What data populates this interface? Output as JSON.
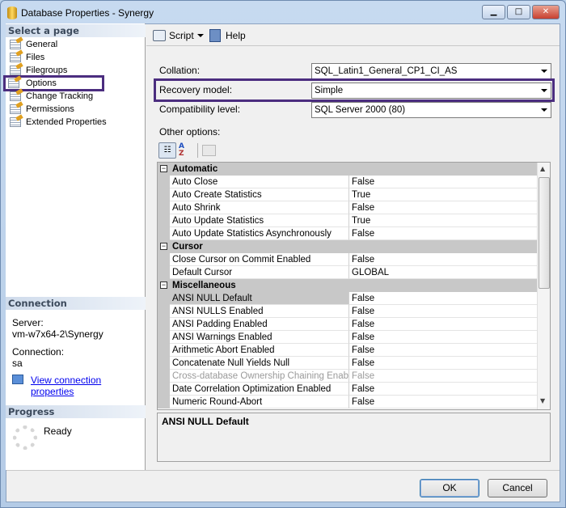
{
  "window": {
    "title": "Database Properties - Synergy"
  },
  "sidebar": {
    "header": "Select a page",
    "items": [
      {
        "label": "General"
      },
      {
        "label": "Files"
      },
      {
        "label": "Filegroups"
      },
      {
        "label": "Options",
        "selected": true
      },
      {
        "label": "Change Tracking"
      },
      {
        "label": "Permissions"
      },
      {
        "label": "Extended Properties"
      }
    ]
  },
  "connection": {
    "header": "Connection",
    "server_label": "Server:",
    "server": "vm-w7x64-2\\Synergy",
    "connection_label": "Connection:",
    "connection": "sa",
    "link": "View connection properties"
  },
  "progress": {
    "header": "Progress",
    "status": "Ready"
  },
  "toolbar": {
    "script": "Script",
    "help": "Help"
  },
  "form": {
    "collation_label": "Collation:",
    "collation": "SQL_Latin1_General_CP1_CI_AS",
    "recovery_label": "Recovery model:",
    "recovery": "Simple",
    "compat_label": "Compatibility level:",
    "compat": "SQL Server 2000 (80)",
    "other_label": "Other options:"
  },
  "grid": {
    "categories": [
      {
        "name": "Automatic",
        "rows": [
          [
            "Auto Close",
            "False"
          ],
          [
            "Auto Create Statistics",
            "True"
          ],
          [
            "Auto Shrink",
            "False"
          ],
          [
            "Auto Update Statistics",
            "True"
          ],
          [
            "Auto Update Statistics Asynchronously",
            "False"
          ]
        ]
      },
      {
        "name": "Cursor",
        "rows": [
          [
            "Close Cursor on Commit Enabled",
            "False"
          ],
          [
            "Default Cursor",
            "GLOBAL"
          ]
        ]
      },
      {
        "name": "Miscellaneous",
        "rows": [
          [
            "ANSI NULL Default",
            "False"
          ],
          [
            "ANSI NULLS Enabled",
            "False"
          ],
          [
            "ANSI Padding Enabled",
            "False"
          ],
          [
            "ANSI Warnings Enabled",
            "False"
          ],
          [
            "Arithmetic Abort Enabled",
            "False"
          ],
          [
            "Concatenate Null Yields Null",
            "False"
          ],
          [
            "Cross-database Ownership Chaining Enabled",
            "False"
          ],
          [
            "Date Correlation Optimization Enabled",
            "False"
          ],
          [
            "Numeric Round-Abort",
            "False"
          ]
        ]
      }
    ],
    "selected": "ANSI NULL Default",
    "disabled": "Cross-database Ownership Chaining Enabled"
  },
  "description": {
    "title": "ANSI NULL Default"
  },
  "buttons": {
    "ok": "OK",
    "cancel": "Cancel"
  },
  "colors": {
    "highlight": "#4b2d7f",
    "link": "#0000ee"
  }
}
